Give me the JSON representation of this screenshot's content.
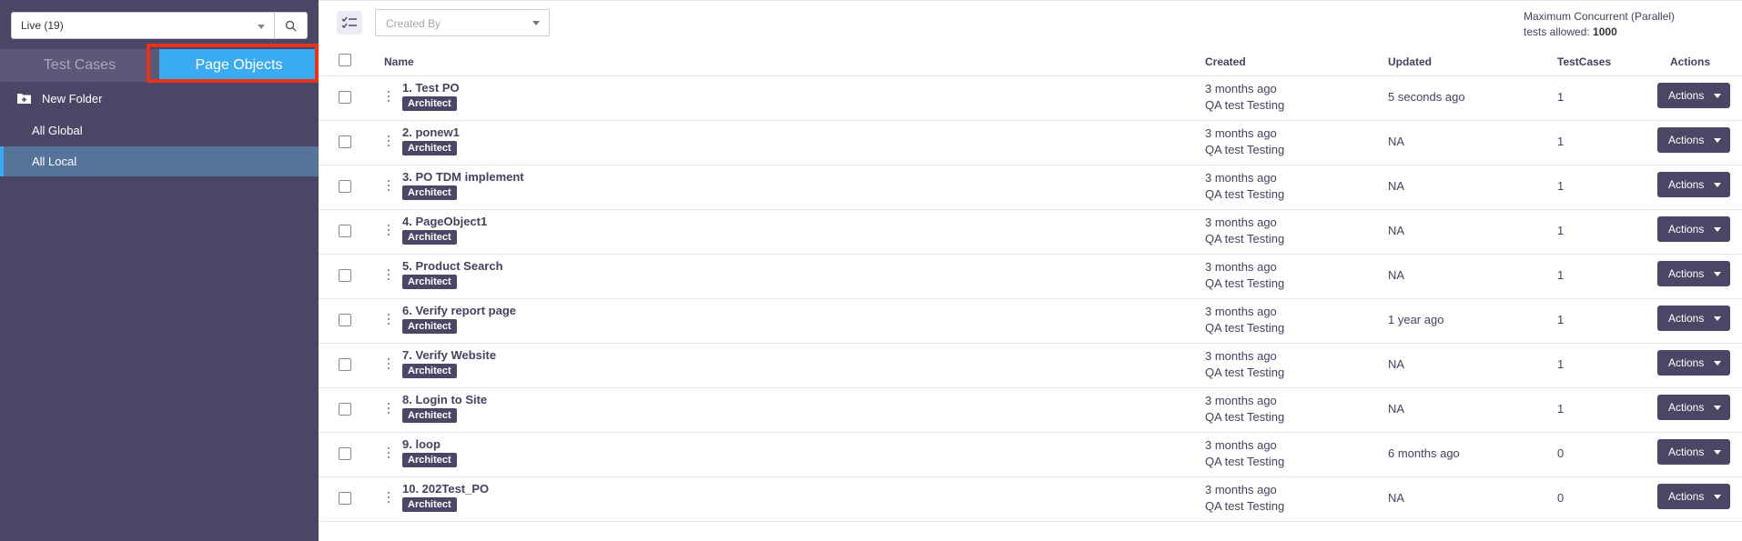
{
  "sidebar": {
    "environment_select": "Live (19)",
    "tabs": {
      "test_cases": "Test Cases",
      "page_objects": "Page Objects"
    },
    "new_folder": "New Folder",
    "items": {
      "all_global": "All Global",
      "all_local": "All Local"
    }
  },
  "toolbar": {
    "created_by_placeholder": "Created By",
    "concurrency_line1": "Maximum Concurrent (Parallel)",
    "concurrency_line2_prefix": "tests allowed:",
    "concurrency_value": "1000"
  },
  "table": {
    "headers": {
      "name": "Name",
      "created": "Created",
      "updated": "Updated",
      "testcases": "TestCases",
      "actions": "Actions"
    },
    "rows": [
      {
        "name": "1. Test PO",
        "badge": "Architect",
        "created_ago": "3 months ago",
        "created_by": "QA test Testing",
        "updated": "5 seconds ago",
        "testcases": "1",
        "action": "Actions"
      },
      {
        "name": "2. ponew1",
        "badge": "Architect",
        "created_ago": "3 months ago",
        "created_by": "QA test Testing",
        "updated": "NA",
        "testcases": "1",
        "action": "Actions"
      },
      {
        "name": "3. PO TDM implement",
        "badge": "Architect",
        "created_ago": "3 months ago",
        "created_by": "QA test Testing",
        "updated": "NA",
        "testcases": "1",
        "action": "Actions"
      },
      {
        "name": "4. PageObject1",
        "badge": "Architect",
        "created_ago": "3 months ago",
        "created_by": "QA test Testing",
        "updated": "NA",
        "testcases": "1",
        "action": "Actions"
      },
      {
        "name": "5. Product Search",
        "badge": "Architect",
        "created_ago": "3 months ago",
        "created_by": "QA test Testing",
        "updated": "NA",
        "testcases": "1",
        "action": "Actions"
      },
      {
        "name": "6. Verify report page",
        "badge": "Architect",
        "created_ago": "3 months ago",
        "created_by": "QA test Testing",
        "updated": "1 year ago",
        "testcases": "1",
        "action": "Actions"
      },
      {
        "name": "7. Verify Website",
        "badge": "Architect",
        "created_ago": "3 months ago",
        "created_by": "QA test Testing",
        "updated": "NA",
        "testcases": "1",
        "action": "Actions"
      },
      {
        "name": "8. Login to Site",
        "badge": "Architect",
        "created_ago": "3 months ago",
        "created_by": "QA test Testing",
        "updated": "NA",
        "testcases": "1",
        "action": "Actions"
      },
      {
        "name": "9. loop",
        "badge": "Architect",
        "created_ago": "3 months ago",
        "created_by": "QA test Testing",
        "updated": "6 months ago",
        "testcases": "0",
        "action": "Actions"
      },
      {
        "name": "10. 202Test_PO",
        "badge": "Architect",
        "created_ago": "3 months ago",
        "created_by": "QA test Testing",
        "updated": "NA",
        "testcases": "0",
        "action": "Actions"
      }
    ]
  },
  "colors": {
    "sidebar_bg": "#4a4766",
    "active_tab": "#3aabf0",
    "highlight": "#e8321e",
    "badge": "#4a4766"
  }
}
